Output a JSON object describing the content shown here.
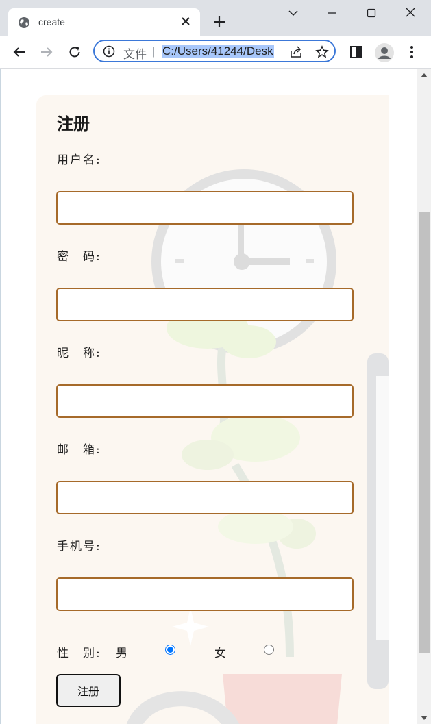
{
  "browser": {
    "tab_title": "create",
    "url_scheme_label": "文件",
    "url_separator": "|",
    "url": "C:/Users/41244/Desk"
  },
  "form": {
    "title": "注册",
    "fields": [
      {
        "label": "用户名:",
        "value": ""
      },
      {
        "label": "密　码:",
        "value": ""
      },
      {
        "label": "昵　称:",
        "value": ""
      },
      {
        "label": "邮　箱:",
        "value": ""
      },
      {
        "label": "手机号:",
        "value": ""
      }
    ],
    "gender": {
      "label": "性　别:",
      "options": [
        {
          "label": "男",
          "checked": true
        },
        {
          "label": "女",
          "checked": false
        }
      ]
    },
    "submit_label": "注册"
  },
  "colors": {
    "accent": "#3c78d8",
    "field_border": "#a66a2a",
    "card_bg": "#fcf7f1"
  }
}
